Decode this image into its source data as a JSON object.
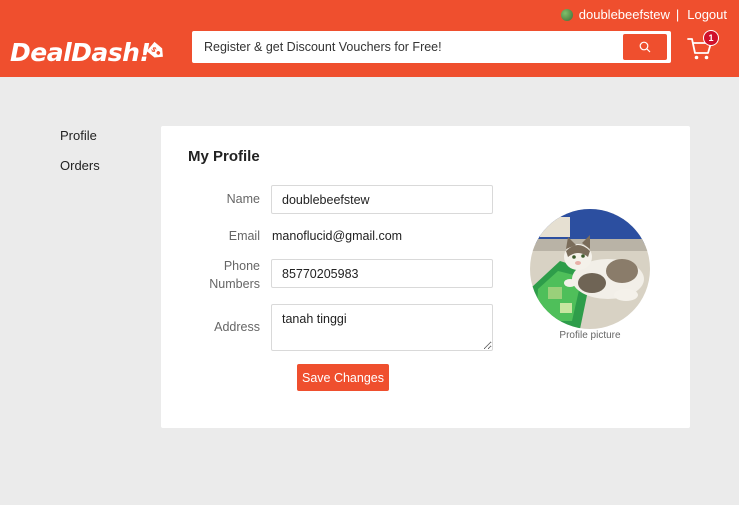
{
  "header": {
    "username": "doublebeefstew",
    "separator": "|",
    "logout_label": "Logout",
    "logo_text": "DealDash!",
    "search_placeholder": "Register & get Discount Vouchers for Free!",
    "cart_count": "1",
    "accent_color": "#ef4f2e"
  },
  "sidebar": {
    "items": [
      {
        "label": "Profile"
      },
      {
        "label": "Orders"
      }
    ]
  },
  "profile": {
    "title": "My Profile",
    "name_label": "Name",
    "name_value": "doublebeefstew",
    "email_label": "Email",
    "email_value": "manoflucid@gmail.com",
    "phone_label_line1": "Phone",
    "phone_label_line2": "Numbers",
    "phone_value": "85770205983",
    "address_label": "Address",
    "address_value": "tanah tinggi",
    "save_label": "Save Changes",
    "picture_caption": "Profile picture"
  }
}
